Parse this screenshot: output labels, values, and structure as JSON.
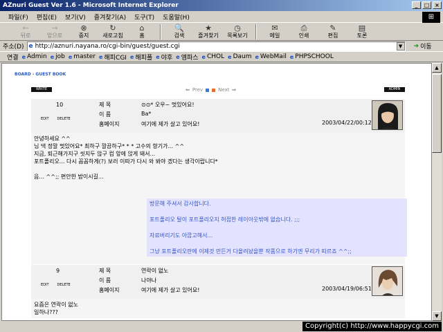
{
  "window": {
    "title": "AZnuri Guest Ver 1.6 - Microsoft Internet Explorer",
    "buttons": [
      "_",
      "□",
      "×"
    ]
  },
  "menu": [
    "파일(F)",
    "편집(E)",
    "보기(V)",
    "즐겨찾기(A)",
    "도구(T)",
    "도움말(H)"
  ],
  "toolbar": [
    {
      "label": "뒤로",
      "icon": "←",
      "disabled": true
    },
    {
      "label": "앞으로",
      "icon": "→",
      "disabled": true
    },
    {
      "label": "중지",
      "icon": "⊗",
      "disabled": false
    },
    {
      "label": "새로고침",
      "icon": "↻",
      "disabled": false
    },
    {
      "label": "홈",
      "icon": "⌂",
      "disabled": false
    },
    {
      "label": "검색",
      "icon": "🔍",
      "disabled": false
    },
    {
      "label": "즐겨찾기",
      "icon": "★",
      "disabled": false
    },
    {
      "label": "목록보기",
      "icon": "◷",
      "disabled": false
    },
    {
      "label": "메일",
      "icon": "✉",
      "disabled": false
    },
    {
      "label": "인쇄",
      "icon": "⎙",
      "disabled": false
    },
    {
      "label": "편집",
      "icon": "✎",
      "disabled": false
    },
    {
      "label": "토론",
      "icon": "▤",
      "disabled": false
    }
  ],
  "address": {
    "label": "주소(D)",
    "url": "http://aznuri.nayana.ro/cgi-bin/guest/guest.cgi",
    "go": "이동"
  },
  "links": {
    "label": "연결",
    "items": [
      "Admin",
      "job",
      "master",
      "해피CGI",
      "해피폴",
      "야후",
      "엠파스",
      "CHOL",
      "Daum",
      "WebMail",
      "PHPSCHOOL"
    ]
  },
  "board": {
    "title": "BOARD - GUEST BOOK",
    "write": "WRITE",
    "admin": "ADMIN",
    "prev": "Prev",
    "next": "Next"
  },
  "posts": [
    {
      "num": "10",
      "edit": "EDIT",
      "delete": "DELETE",
      "subject_label": "제 목",
      "name_label": "이 름",
      "home_label": "홈페이지",
      "subject": "⊙⊙* 오우~ 멋있어요!",
      "name": "Ba*",
      "home": "여기에 제가 살고 있어요!",
      "date": "2003/04/22/00:12",
      "body": [
        "안녕하세요 ^^",
        "님 댁 정말 멋있어요* 최하구 깔끔하구* * * 고수의 향기가... ^^",
        "지금, 퇴근해가지구 씻지두 않구 컴 앞에 앉게 돼서...",
        "포트폴리오... 다시 꼼꼼하게(?) 보러 이따가 다시 와 봐야 겠다는 생각이랍니다*",
        "",
        "음... ^^;; 편안한 밤이시길..."
      ],
      "reply": [
        "방문해 주셔서 감사합니다.",
        "포트폴리오 탈이 포트폴리오지 허접한 레이아웃밖에 없습니다. ;;;",
        "자료버리기도 아깝고해서...",
        "그냥 포트폴리오란에 이제것 만든거 다올려놨을뿐 작품으로 하기엔 무리가 따르죠 ^^;;"
      ]
    },
    {
      "num": "9",
      "edit": "EDIT",
      "delete": "DELETE",
      "subject_label": "제 목",
      "name_label": "이 름",
      "home_label": "홈페이지",
      "subject": "연락이 없노",
      "name": "나야나",
      "home": "여기에 제가 살고 있어요!",
      "date": "2003/04/19/06:51",
      "body": [
        "요즘은 연락이 없노",
        "일하나???"
      ]
    }
  ],
  "status": {
    "copyright": "Copyright(c) http://www.happycgi.com"
  }
}
